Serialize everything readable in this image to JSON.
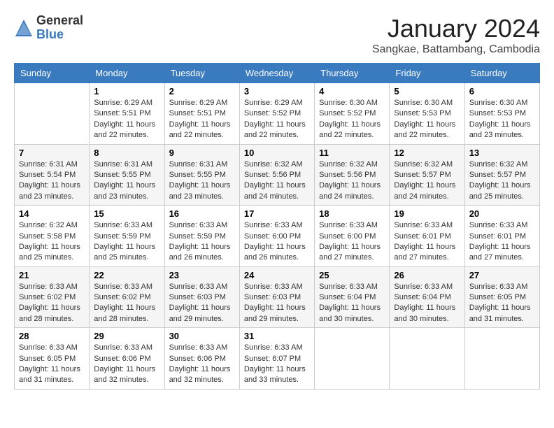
{
  "header": {
    "logo_general": "General",
    "logo_blue": "Blue",
    "month_year": "January 2024",
    "location": "Sangkae, Battambang, Cambodia"
  },
  "days_of_week": [
    "Sunday",
    "Monday",
    "Tuesday",
    "Wednesday",
    "Thursday",
    "Friday",
    "Saturday"
  ],
  "weeks": [
    [
      {
        "day": "",
        "info": ""
      },
      {
        "day": "1",
        "info": "Sunrise: 6:29 AM\nSunset: 5:51 PM\nDaylight: 11 hours\nand 22 minutes."
      },
      {
        "day": "2",
        "info": "Sunrise: 6:29 AM\nSunset: 5:51 PM\nDaylight: 11 hours\nand 22 minutes."
      },
      {
        "day": "3",
        "info": "Sunrise: 6:29 AM\nSunset: 5:52 PM\nDaylight: 11 hours\nand 22 minutes."
      },
      {
        "day": "4",
        "info": "Sunrise: 6:30 AM\nSunset: 5:52 PM\nDaylight: 11 hours\nand 22 minutes."
      },
      {
        "day": "5",
        "info": "Sunrise: 6:30 AM\nSunset: 5:53 PM\nDaylight: 11 hours\nand 22 minutes."
      },
      {
        "day": "6",
        "info": "Sunrise: 6:30 AM\nSunset: 5:53 PM\nDaylight: 11 hours\nand 23 minutes."
      }
    ],
    [
      {
        "day": "7",
        "info": "Sunrise: 6:31 AM\nSunset: 5:54 PM\nDaylight: 11 hours\nand 23 minutes."
      },
      {
        "day": "8",
        "info": "Sunrise: 6:31 AM\nSunset: 5:55 PM\nDaylight: 11 hours\nand 23 minutes."
      },
      {
        "day": "9",
        "info": "Sunrise: 6:31 AM\nSunset: 5:55 PM\nDaylight: 11 hours\nand 23 minutes."
      },
      {
        "day": "10",
        "info": "Sunrise: 6:32 AM\nSunset: 5:56 PM\nDaylight: 11 hours\nand 24 minutes."
      },
      {
        "day": "11",
        "info": "Sunrise: 6:32 AM\nSunset: 5:56 PM\nDaylight: 11 hours\nand 24 minutes."
      },
      {
        "day": "12",
        "info": "Sunrise: 6:32 AM\nSunset: 5:57 PM\nDaylight: 11 hours\nand 24 minutes."
      },
      {
        "day": "13",
        "info": "Sunrise: 6:32 AM\nSunset: 5:57 PM\nDaylight: 11 hours\nand 25 minutes."
      }
    ],
    [
      {
        "day": "14",
        "info": "Sunrise: 6:32 AM\nSunset: 5:58 PM\nDaylight: 11 hours\nand 25 minutes."
      },
      {
        "day": "15",
        "info": "Sunrise: 6:33 AM\nSunset: 5:59 PM\nDaylight: 11 hours\nand 25 minutes."
      },
      {
        "day": "16",
        "info": "Sunrise: 6:33 AM\nSunset: 5:59 PM\nDaylight: 11 hours\nand 26 minutes."
      },
      {
        "day": "17",
        "info": "Sunrise: 6:33 AM\nSunset: 6:00 PM\nDaylight: 11 hours\nand 26 minutes."
      },
      {
        "day": "18",
        "info": "Sunrise: 6:33 AM\nSunset: 6:00 PM\nDaylight: 11 hours\nand 27 minutes."
      },
      {
        "day": "19",
        "info": "Sunrise: 6:33 AM\nSunset: 6:01 PM\nDaylight: 11 hours\nand 27 minutes."
      },
      {
        "day": "20",
        "info": "Sunrise: 6:33 AM\nSunset: 6:01 PM\nDaylight: 11 hours\nand 27 minutes."
      }
    ],
    [
      {
        "day": "21",
        "info": "Sunrise: 6:33 AM\nSunset: 6:02 PM\nDaylight: 11 hours\nand 28 minutes."
      },
      {
        "day": "22",
        "info": "Sunrise: 6:33 AM\nSunset: 6:02 PM\nDaylight: 11 hours\nand 28 minutes."
      },
      {
        "day": "23",
        "info": "Sunrise: 6:33 AM\nSunset: 6:03 PM\nDaylight: 11 hours\nand 29 minutes."
      },
      {
        "day": "24",
        "info": "Sunrise: 6:33 AM\nSunset: 6:03 PM\nDaylight: 11 hours\nand 29 minutes."
      },
      {
        "day": "25",
        "info": "Sunrise: 6:33 AM\nSunset: 6:04 PM\nDaylight: 11 hours\nand 30 minutes."
      },
      {
        "day": "26",
        "info": "Sunrise: 6:33 AM\nSunset: 6:04 PM\nDaylight: 11 hours\nand 30 minutes."
      },
      {
        "day": "27",
        "info": "Sunrise: 6:33 AM\nSunset: 6:05 PM\nDaylight: 11 hours\nand 31 minutes."
      }
    ],
    [
      {
        "day": "28",
        "info": "Sunrise: 6:33 AM\nSunset: 6:05 PM\nDaylight: 11 hours\nand 31 minutes."
      },
      {
        "day": "29",
        "info": "Sunrise: 6:33 AM\nSunset: 6:06 PM\nDaylight: 11 hours\nand 32 minutes."
      },
      {
        "day": "30",
        "info": "Sunrise: 6:33 AM\nSunset: 6:06 PM\nDaylight: 11 hours\nand 32 minutes."
      },
      {
        "day": "31",
        "info": "Sunrise: 6:33 AM\nSunset: 6:07 PM\nDaylight: 11 hours\nand 33 minutes."
      },
      {
        "day": "",
        "info": ""
      },
      {
        "day": "",
        "info": ""
      },
      {
        "day": "",
        "info": ""
      }
    ]
  ]
}
